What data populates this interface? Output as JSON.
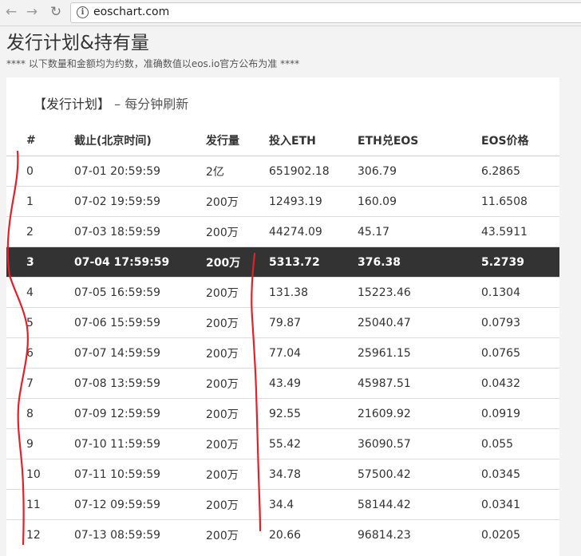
{
  "browser": {
    "url": "eoschart.com",
    "back_glyph": "←",
    "forward_glyph": "→",
    "reload_glyph": "↻",
    "info_glyph": "i"
  },
  "page": {
    "title": "发行计划&持有量",
    "note": "**** 以下数量和金额均为约数，准确数值以eos.io官方公布为准 ****"
  },
  "panel": {
    "title": "【发行计划】",
    "subtitle": " – 每分钟刷新"
  },
  "table": {
    "headers": [
      "#",
      "截止(北京时间)",
      "发行量",
      "投入ETH",
      "ETH兑EOS",
      "EOS价格"
    ],
    "rows": [
      [
        "0",
        "07-01 20:59:59",
        "2亿",
        "651902.18",
        "306.79",
        "6.2865"
      ],
      [
        "1",
        "07-02 19:59:59",
        "200万",
        "12493.19",
        "160.09",
        "11.6508"
      ],
      [
        "2",
        "07-03 18:59:59",
        "200万",
        "44274.09",
        "45.17",
        "43.5911"
      ],
      [
        "3",
        "07-04 17:59:59",
        "200万",
        "5313.72",
        "376.38",
        "5.2739"
      ],
      [
        "4",
        "07-05 16:59:59",
        "200万",
        "131.38",
        "15223.46",
        "0.1304"
      ],
      [
        "5",
        "07-06 15:59:59",
        "200万",
        "79.87",
        "25040.47",
        "0.0793"
      ],
      [
        "6",
        "07-07 14:59:59",
        "200万",
        "77.04",
        "25961.15",
        "0.0765"
      ],
      [
        "7",
        "07-08 13:59:59",
        "200万",
        "43.49",
        "45987.51",
        "0.0432"
      ],
      [
        "8",
        "07-09 12:59:59",
        "200万",
        "92.55",
        "21609.92",
        "0.0919"
      ],
      [
        "9",
        "07-10 11:59:59",
        "200万",
        "55.42",
        "36090.57",
        "0.055"
      ],
      [
        "10",
        "07-11 10:59:59",
        "200万",
        "34.78",
        "57500.42",
        "0.0345"
      ],
      [
        "11",
        "07-12 09:59:59",
        "200万",
        "34.4",
        "58144.42",
        "0.0341"
      ],
      [
        "12",
        "07-13 08:59:59",
        "200万",
        "20.66",
        "96814.23",
        "0.0205"
      ]
    ],
    "highlighted_row": 3
  },
  "colors": {
    "highlight_bg": "#333333",
    "annotation_red": "#e0222a"
  }
}
